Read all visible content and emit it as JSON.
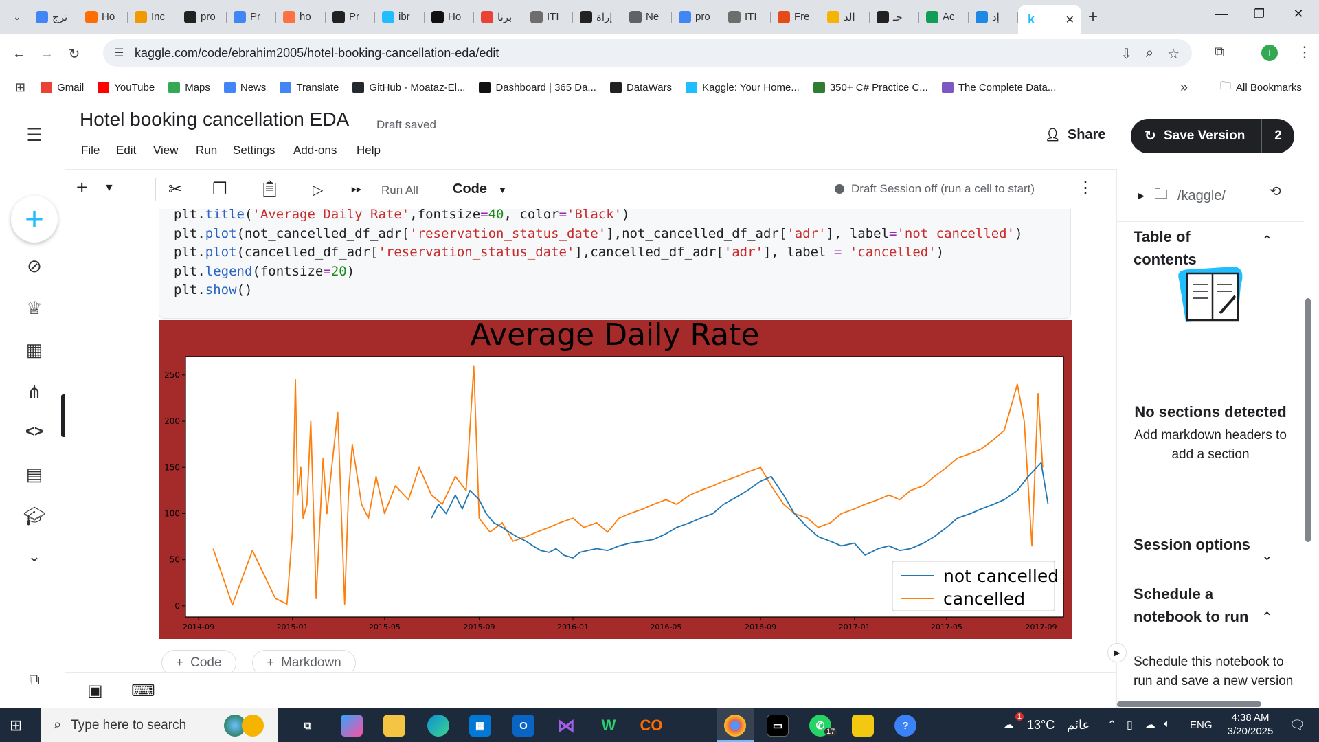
{
  "browser": {
    "tabs": [
      {
        "label": "ترج",
        "color": "#4285f4",
        "icon": "g-translate-icon"
      },
      {
        "label": "Ho",
        "color": "#ff6d00",
        "icon": "loop-icon"
      },
      {
        "label": "Inc",
        "color": "#f29900",
        "icon": "doc-icon"
      },
      {
        "label": "pro",
        "color": "#222222",
        "icon": "openai-icon"
      },
      {
        "label": "Pr",
        "color": "#4285f4",
        "icon": "docs-icon"
      },
      {
        "label": "ho",
        "color": "#ff7043",
        "icon": "slides-icon"
      },
      {
        "label": "Pr",
        "color": "#222222",
        "icon": "openai-icon"
      },
      {
        "label": "ibr",
        "color": "#20beff",
        "icon": "kaggle-icon"
      },
      {
        "label": "Ho",
        "color": "#111111",
        "icon": "upwork-icon"
      },
      {
        "label": "برنا",
        "color": "#ea4335",
        "icon": "gmail-icon"
      },
      {
        "label": "ITI",
        "color": "#6d6d6d",
        "icon": "iti-icon"
      },
      {
        "label": "إراة",
        "color": "#222222",
        "icon": "openai-icon"
      },
      {
        "label": "Ne",
        "color": "#5f6368",
        "icon": "github-icon"
      },
      {
        "label": "pro",
        "color": "#4285f4",
        "icon": "docs-icon"
      },
      {
        "label": "ITI",
        "color": "#6d6d6d",
        "icon": "iti-icon"
      },
      {
        "label": "Fre",
        "color": "#e64a19",
        "icon": "free-icon"
      },
      {
        "label": "الد",
        "color": "#f4b400",
        "icon": "five-icon"
      },
      {
        "label": "حـ",
        "color": "#222222",
        "icon": "bubble-icon"
      },
      {
        "label": "Ac",
        "color": "#0f9d58",
        "icon": "sheets-plus-icon"
      },
      {
        "label": "إد",
        "color": "#1e88e5",
        "icon": "circle-icon"
      }
    ],
    "active_tab": {
      "label": "k",
      "close": "✕"
    },
    "new_tab": "+",
    "window_controls": {
      "minimize": "—",
      "maximize": "❐",
      "close": "✕"
    },
    "url": "kaggle.com/code/ebrahim2005/hotel-booking-cancellation-eda/edit",
    "bookmarks": [
      {
        "label": "Gmail",
        "color": "#ea4335",
        "icon": "gmail-icon"
      },
      {
        "label": "YouTube",
        "color": "#ff0000",
        "icon": "youtube-icon"
      },
      {
        "label": "Maps",
        "color": "#34a853",
        "icon": "maps-icon"
      },
      {
        "label": "News",
        "color": "#4285f4",
        "icon": "news-icon"
      },
      {
        "label": "Translate",
        "color": "#4285f4",
        "icon": "translate-icon"
      },
      {
        "label": "GitHub - Moataz-El...",
        "color": "#24292e",
        "icon": "github-icon"
      },
      {
        "label": "Dashboard | 365 Da...",
        "color": "#111111",
        "icon": "dashboard-icon"
      },
      {
        "label": "DataWars",
        "color": "#222222",
        "icon": "datawars-icon"
      },
      {
        "label": "Kaggle: Your Home...",
        "color": "#20beff",
        "icon": "kaggle-icon"
      },
      {
        "label": "350+ C# Practice C...",
        "color": "#2e7d32",
        "icon": "practice-icon"
      },
      {
        "label": "The Complete Data...",
        "color": "#7e57c2",
        "icon": "udemy-icon"
      }
    ],
    "bookmarks_more": "»",
    "all_bookmarks": "All Bookmarks"
  },
  "notebook": {
    "title": "Hotel booking cancellation EDA",
    "status": "Draft saved",
    "menu": [
      "File",
      "Edit",
      "View",
      "Run",
      "Settings",
      "Add-ons",
      "Help"
    ],
    "share_label": "Share",
    "save_version_label": "Save Version",
    "save_version_count": "2",
    "run_all_label": "Run All",
    "cell_type": "Code",
    "session_status": "Draft Session off (run a cell to start)",
    "add_code_label": "Code",
    "add_markdown_label": "Markdown"
  },
  "code_lines": [
    "plt.title('Average Daily Rate',fontsize=40, color='Black')",
    "plt.plot(not_cancelled_df_adr['reservation_status_date'],not_cancelled_df_adr['adr'], label='not cancelled')",
    "plt.plot(cancelled_df_adr['reservation_status_date'],cancelled_df_adr['adr'], label = 'cancelled')",
    "plt.legend(fontsize=20)",
    "plt.show()"
  ],
  "right_panel": {
    "path": "/kaggle/​",
    "toc_title": "Table of contents",
    "empty_title": "No sections detected",
    "empty_text": "Add markdown headers to add a section",
    "session_title": "Session options",
    "schedule_title": "Schedule a notebook to run",
    "schedule_text": "Schedule this notebook to run and save a new version on a future date"
  },
  "taskbar": {
    "search_placeholder": "Type here to search",
    "weather": "13°C",
    "weather_label": "عائم",
    "language": "ENG",
    "time": "4:38 AM",
    "date": "3/20/2025",
    "whatsapp_badge": "17",
    "notification_badge": "1"
  },
  "colors": {
    "figure_bg": "#a52a2a",
    "series_not_cancelled": "#1f77b4",
    "series_cancelled": "#ff7f0e",
    "kaggle_blue": "#20beff",
    "taskbar": "#1c2a3c"
  },
  "chart_data": {
    "type": "line",
    "title": "Average Daily Rate",
    "xlabel": "",
    "ylabel": "",
    "x_ticks": [
      "2014-09",
      "2015-01",
      "2015-05",
      "2015-09",
      "2016-01",
      "2016-05",
      "2016-09",
      "2017-01",
      "2017-05",
      "2017-09"
    ],
    "y_ticks": [
      0,
      50,
      100,
      150,
      200,
      250
    ],
    "ylim": [
      -12,
      270
    ],
    "xlim": [
      "2014-08-15",
      "2017-09-30"
    ],
    "legend": {
      "position": "lower-right",
      "entries": [
        "not cancelled",
        "cancelled"
      ]
    },
    "grid": false,
    "series": [
      {
        "name": "not cancelled",
        "x": [
          "2015-07-01",
          "2015-07-10",
          "2015-07-20",
          "2015-08-01",
          "2015-08-10",
          "2015-08-20",
          "2015-09-01",
          "2015-09-10",
          "2015-09-20",
          "2015-10-01",
          "2015-10-10",
          "2015-10-20",
          "2015-11-01",
          "2015-11-10",
          "2015-11-20",
          "2015-12-01",
          "2015-12-10",
          "2015-12-20",
          "2016-01-01",
          "2016-01-10",
          "2016-01-20",
          "2016-02-01",
          "2016-02-15",
          "2016-03-01",
          "2016-03-15",
          "2016-04-01",
          "2016-04-15",
          "2016-05-01",
          "2016-05-15",
          "2016-06-01",
          "2016-06-15",
          "2016-07-01",
          "2016-07-15",
          "2016-08-01",
          "2016-08-15",
          "2016-09-01",
          "2016-09-15",
          "2016-10-01",
          "2016-10-15",
          "2016-11-01",
          "2016-11-15",
          "2016-12-01",
          "2016-12-15",
          "2017-01-01",
          "2017-01-15",
          "2017-02-01",
          "2017-02-15",
          "2017-03-01",
          "2017-03-15",
          "2017-04-01",
          "2017-04-15",
          "2017-05-01",
          "2017-05-15",
          "2017-06-01",
          "2017-06-15",
          "2017-07-01",
          "2017-07-15",
          "2017-08-01",
          "2017-08-15",
          "2017-09-01",
          "2017-09-10"
        ],
        "values": [
          95,
          110,
          100,
          120,
          105,
          125,
          115,
          100,
          90,
          85,
          80,
          75,
          70,
          65,
          60,
          58,
          62,
          55,
          52,
          58,
          60,
          62,
          60,
          65,
          68,
          70,
          72,
          78,
          85,
          90,
          95,
          100,
          110,
          118,
          125,
          135,
          140,
          120,
          100,
          85,
          75,
          70,
          65,
          68,
          55,
          62,
          65,
          60,
          62,
          68,
          75,
          85,
          95,
          100,
          105,
          110,
          115,
          125,
          140,
          155,
          110
        ]
      },
      {
        "name": "cancelled",
        "x": [
          "2014-09-20",
          "2014-10-15",
          "2014-11-10",
          "2014-12-10",
          "2014-12-25",
          "2015-01-01",
          "2015-01-05",
          "2015-01-08",
          "2015-01-12",
          "2015-01-15",
          "2015-01-20",
          "2015-01-25",
          "2015-02-01",
          "2015-02-10",
          "2015-02-15",
          "2015-02-20",
          "2015-03-01",
          "2015-03-10",
          "2015-03-15",
          "2015-03-20",
          "2015-04-01",
          "2015-04-10",
          "2015-04-20",
          "2015-05-01",
          "2015-05-15",
          "2015-06-01",
          "2015-06-15",
          "2015-07-01",
          "2015-07-15",
          "2015-08-01",
          "2015-08-15",
          "2015-08-25",
          "2015-09-01",
          "2015-09-15",
          "2015-10-01",
          "2015-10-15",
          "2015-11-01",
          "2015-11-15",
          "2015-12-01",
          "2015-12-15",
          "2016-01-01",
          "2016-01-15",
          "2016-02-01",
          "2016-02-15",
          "2016-03-01",
          "2016-03-15",
          "2016-04-01",
          "2016-04-15",
          "2016-05-01",
          "2016-05-15",
          "2016-06-01",
          "2016-06-15",
          "2016-07-01",
          "2016-07-15",
          "2016-08-01",
          "2016-08-15",
          "2016-09-01",
          "2016-09-15",
          "2016-10-01",
          "2016-10-15",
          "2016-11-01",
          "2016-11-15",
          "2016-12-01",
          "2016-12-15",
          "2017-01-01",
          "2017-01-15",
          "2017-02-01",
          "2017-02-15",
          "2017-03-01",
          "2017-03-15",
          "2017-04-01",
          "2017-04-15",
          "2017-05-01",
          "2017-05-15",
          "2017-06-01",
          "2017-06-15",
          "2017-07-01",
          "2017-07-15",
          "2017-08-01",
          "2017-08-10",
          "2017-08-20",
          "2017-08-28",
          "2017-09-03"
        ],
        "values": [
          62,
          1,
          60,
          8,
          2,
          80,
          245,
          120,
          150,
          95,
          110,
          200,
          8,
          160,
          100,
          140,
          210,
          2,
          120,
          175,
          110,
          95,
          140,
          100,
          130,
          115,
          150,
          120,
          110,
          140,
          125,
          260,
          95,
          80,
          90,
          70,
          75,
          80,
          85,
          90,
          95,
          85,
          90,
          80,
          95,
          100,
          105,
          110,
          115,
          110,
          120,
          125,
          130,
          135,
          140,
          145,
          150,
          130,
          110,
          100,
          95,
          85,
          90,
          100,
          105,
          110,
          115,
          120,
          115,
          125,
          130,
          140,
          150,
          160,
          165,
          170,
          180,
          190,
          240,
          200,
          65,
          230,
          150
        ]
      }
    ]
  }
}
